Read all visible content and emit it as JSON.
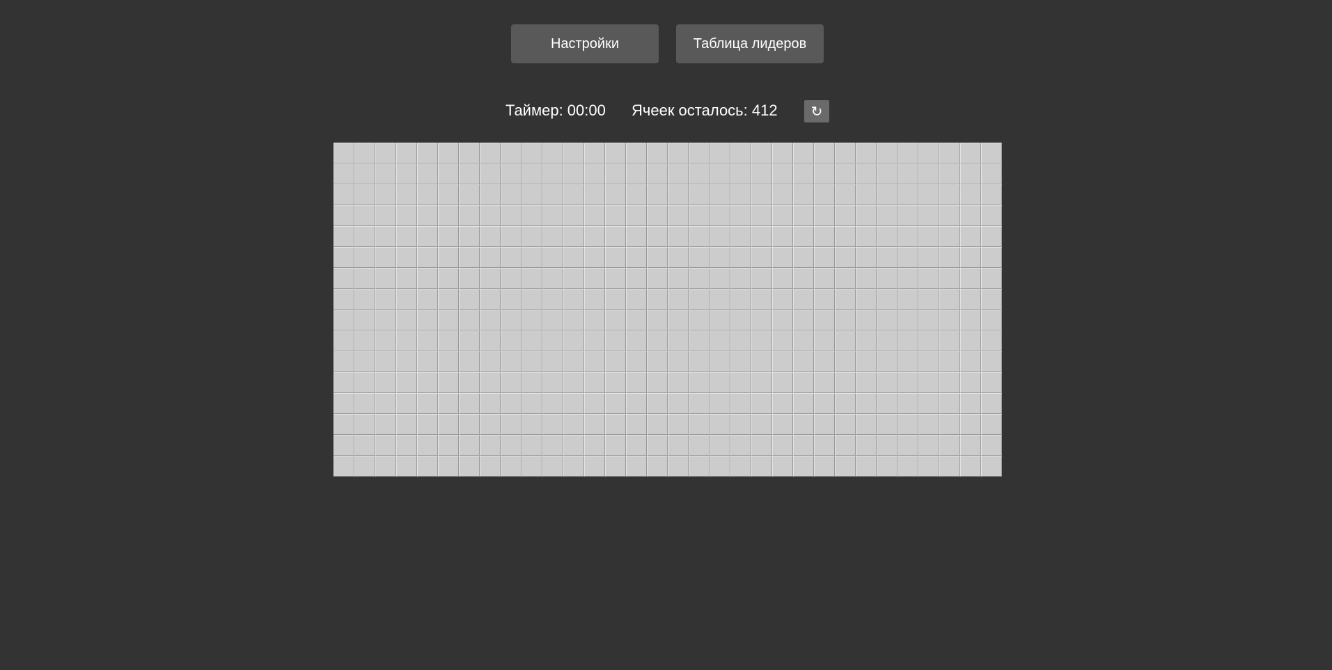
{
  "toolbar": {
    "settings_label": "Настройки",
    "leaderboard_label": "Таблица лидеров"
  },
  "status": {
    "timer_text": "Таймер: 00:00",
    "cells_left_text": "Ячеек осталось: 412",
    "restart_icon": "↻"
  },
  "board": {
    "columns": 32,
    "rows": 16,
    "cell_state": "unopened"
  },
  "colors": {
    "background": "#333333",
    "button": "#595959",
    "cell": "#cccccc",
    "cell_border": "#999999"
  }
}
